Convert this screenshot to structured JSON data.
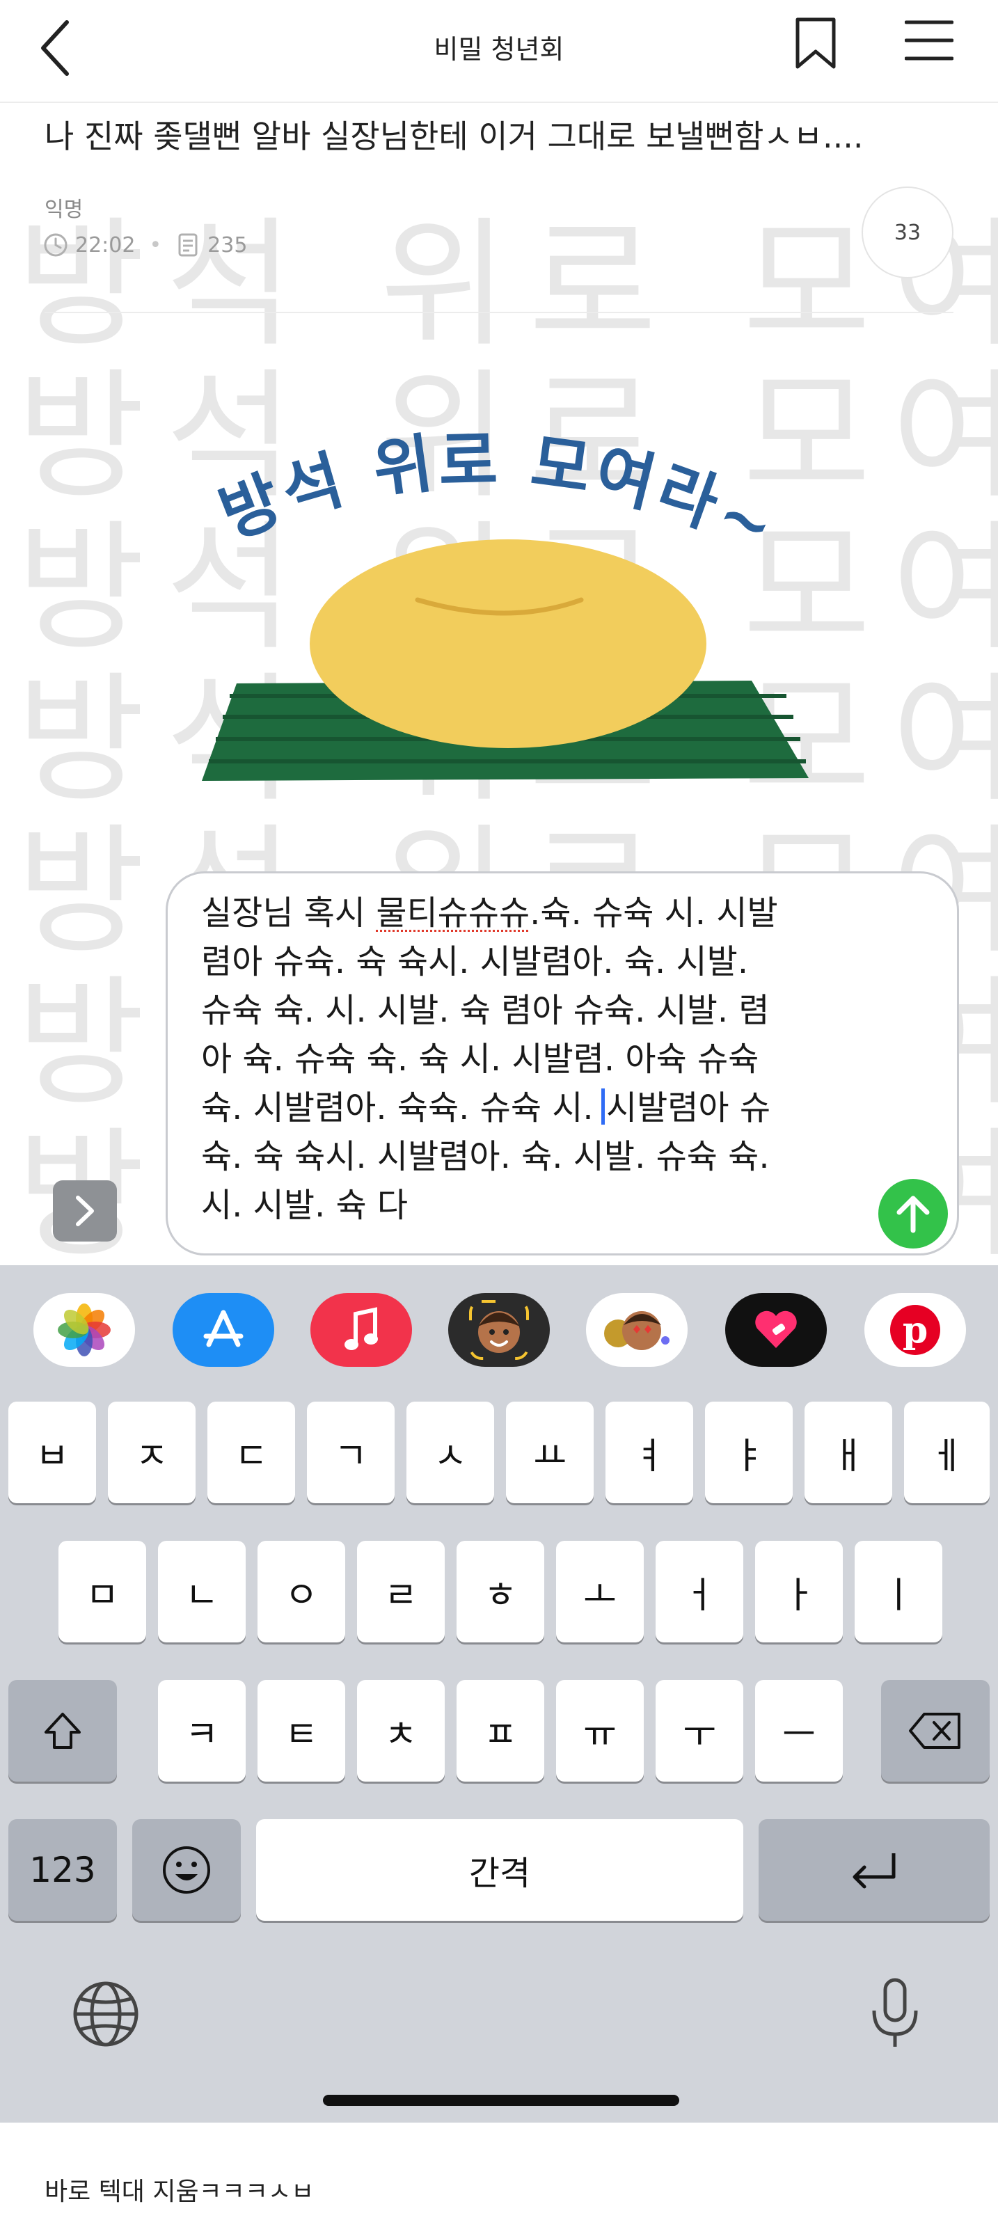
{
  "nav": {
    "title": "비밀 청년회"
  },
  "post": {
    "title": "나 진짜 좆댈뻔 알바 실장님한테 이거 그대로 보낼뻔함ㅅㅂ....",
    "author": "익명",
    "time": "22:02",
    "views": "235",
    "comment_count": "33"
  },
  "banner": {
    "text": "방석 위로 모여라~"
  },
  "compose": {
    "lines": [
      "실장님 혹시 물티슈슈슈.슉. 슈슉 시. 시발",
      "렴아 슈슉. 슉 슉시. 시발렴아. 슉. 시발.",
      "슈슉 슉. 시. 시발. 슉 렴아 슈슉. 시발. 렴",
      "아 슉. 슈슉 슉. 슉 시. 시발렴. 아슉 슈슉",
      "슉. 시발렴아. 슉슉. 슈슉 시.",
      "시발렴아 슈",
      "슉. 슉 슉시. 시발렴아. 슉. 시발. 슈슉 슉.",
      "시. 시발. 슉 다"
    ],
    "underlined": "물티슈슈슈"
  },
  "keyboard": {
    "row1": [
      "ㅂ",
      "ㅈ",
      "ㄷ",
      "ㄱ",
      "ㅅ",
      "ㅛ",
      "ㅕ",
      "ㅑ",
      "ㅐ",
      "ㅔ"
    ],
    "row2": [
      "ㅁ",
      "ㄴ",
      "ㅇ",
      "ㄹ",
      "ㅎ",
      "ㅗ",
      "ㅓ",
      "ㅏ",
      "ㅣ"
    ],
    "row3": [
      "ㅋ",
      "ㅌ",
      "ㅊ",
      "ㅍ",
      "ㅠ",
      "ㅜ",
      "ㅡ"
    ],
    "numbers_label": "123",
    "space_label": "간격"
  },
  "app_strip": [
    "photos-icon",
    "app-store-icon",
    "music-icon",
    "memoji-icon",
    "memoji-stickers-icon",
    "heart-app-icon",
    "pinterest-icon"
  ],
  "caption": "바로 텍대 지움ㅋㅋㅋㅅㅂ",
  "watermark": "방석 위로 모여라",
  "colors": {
    "send": "#33c24a",
    "caret": "#2f6cf5",
    "banner_text": "#2a5f9a",
    "cushion": "#f2cd5c",
    "mat": "#1e6b3e"
  }
}
